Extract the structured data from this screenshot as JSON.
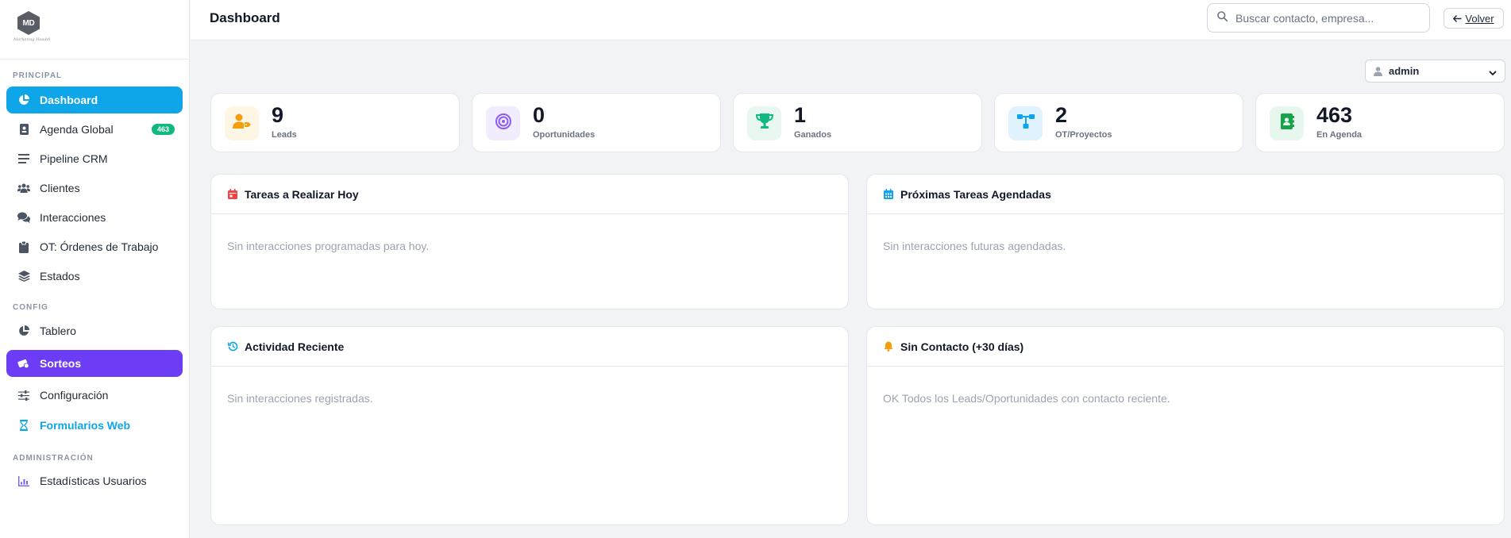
{
  "brand": {
    "logo_text": "MD",
    "logo_subtitle": "Marketing Hoaddi"
  },
  "sidebar": {
    "sections": [
      {
        "label": "PRINCIPAL",
        "items": [
          {
            "label": "Dashboard",
            "icon": "pie-chart-icon",
            "active": true
          },
          {
            "label": "Agenda Global",
            "icon": "address-book-icon",
            "badge": "463"
          },
          {
            "label": "Pipeline CRM",
            "icon": "bars-icon"
          },
          {
            "label": "Clientes",
            "icon": "users-icon"
          },
          {
            "label": "Interacciones",
            "icon": "comments-icon"
          },
          {
            "label": "OT: Órdenes de Trabajo",
            "icon": "clipboard-icon"
          },
          {
            "label": "Estados",
            "icon": "layers-icon"
          }
        ]
      },
      {
        "label": "CONFIG",
        "items": [
          {
            "label": "Tablero",
            "icon": "pie-chart-icon"
          },
          {
            "label": "Sorteos",
            "icon": "ticket-icon",
            "highlight": true
          },
          {
            "label": "Configuración",
            "icon": "sliders-icon"
          },
          {
            "label": "Formularios Web",
            "icon": "hourglass-icon",
            "link": true
          }
        ]
      },
      {
        "label": "ADMINISTRACIÓN",
        "items": [
          {
            "label": "Estadísticas Usuarios",
            "icon": "bar-chart-icon"
          }
        ]
      }
    ]
  },
  "header": {
    "title": "Dashboard",
    "search_placeholder": "Buscar contacto, empresa...",
    "back_label": "Volver"
  },
  "user_select": {
    "value": "admin"
  },
  "stats": [
    {
      "value": "9",
      "label": "Leads",
      "icon": "user-tag-icon",
      "color": "#f59e0b",
      "bg": "#fef6e4"
    },
    {
      "value": "0",
      "label": "Oportunidades",
      "icon": "target-icon",
      "color": "#8b5cf6",
      "bg": "#f1ecfe"
    },
    {
      "value": "1",
      "label": "Ganados",
      "icon": "trophy-icon",
      "color": "#10b981",
      "bg": "#e8f8f1"
    },
    {
      "value": "2",
      "label": "OT/Proyectos",
      "icon": "sitemap-icon",
      "color": "#0ea5e9",
      "bg": "#e0f2fe"
    },
    {
      "value": "463",
      "label": "En Agenda",
      "icon": "contact-book-icon",
      "color": "#16a34a",
      "bg": "#e7f7ee"
    }
  ],
  "panels": {
    "today": {
      "title": "Tareas a Realizar Hoy",
      "empty": "Sin interacciones programadas para hoy.",
      "icon": "calendar-day-icon",
      "color": "#ef4444"
    },
    "upcoming": {
      "title": "Próximas Tareas Agendadas",
      "empty": "Sin interacciones futuras agendadas.",
      "icon": "calendar-icon",
      "color": "#0ea5e9"
    },
    "recent": {
      "title": "Actividad Reciente",
      "empty": "Sin interacciones registradas.",
      "icon": "history-icon",
      "color": "#0ea5e9"
    },
    "no_contact": {
      "title": "Sin Contacto (+30 días)",
      "empty": "OK Todos los Leads/Oportunidades con contacto reciente.",
      "icon": "bell-icon",
      "color": "#f59e0b"
    }
  }
}
